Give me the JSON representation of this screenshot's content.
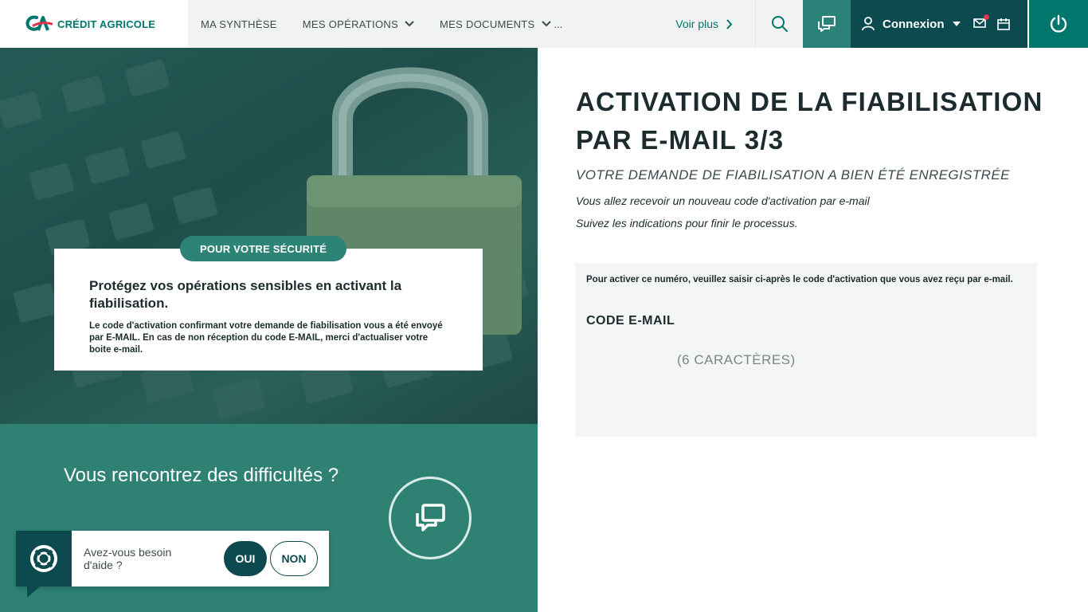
{
  "header": {
    "brand": "CRÉDIT AGRICOLE",
    "nav": [
      {
        "label": "MA SYNTHÈSE",
        "has_chevron": false
      },
      {
        "label": "MES OPÉRATIONS",
        "has_chevron": true
      },
      {
        "label": "MES DOCUMENTS",
        "has_chevron": true
      }
    ],
    "nav_ellipsis": "...",
    "more_label": "Voir plus",
    "connexion_label": "Connexion"
  },
  "hero": {
    "pill": "POUR VOTRE SÉCURITÉ",
    "title": "Protégez vos opérations sensibles en activant la fiabilisation.",
    "text": "Le code d'activation confirmant votre demande de fiabilisation vous a été envoyé par E-MAIL. En cas de non réception du code E-MAIL, merci d'actualiser votre boite e-mail."
  },
  "help": {
    "question": "Vous rencontrez des difficultés ?"
  },
  "widget": {
    "text": "Avez-vous besoin d'aide ?",
    "yes": "OUI",
    "no": "NON"
  },
  "main": {
    "title": "ACTIVATION DE LA FIABILISATION PAR E-MAIL 3/3",
    "subtitle": "VOTRE DEMANDE DE FIABILISATION A BIEN ÉTÉ ENREGISTRÉE",
    "info1": "Vous allez recevoir un nouveau code d'activation par e-mail",
    "info2": "Suivez les indications pour finir le processus.",
    "instruction": "Pour activer ce numéro, veuillez saisir ci-après le code d'activation que vous avez reçu par e-mail.",
    "code_label": "CODE E-MAIL",
    "code_placeholder": "(6 CARACTÈRES)",
    "code_value": ""
  },
  "colors": {
    "brand_green": "#00776c",
    "dark_teal": "#0b4a4f",
    "mid_teal": "#2e8173",
    "notification": "#e3364d"
  }
}
